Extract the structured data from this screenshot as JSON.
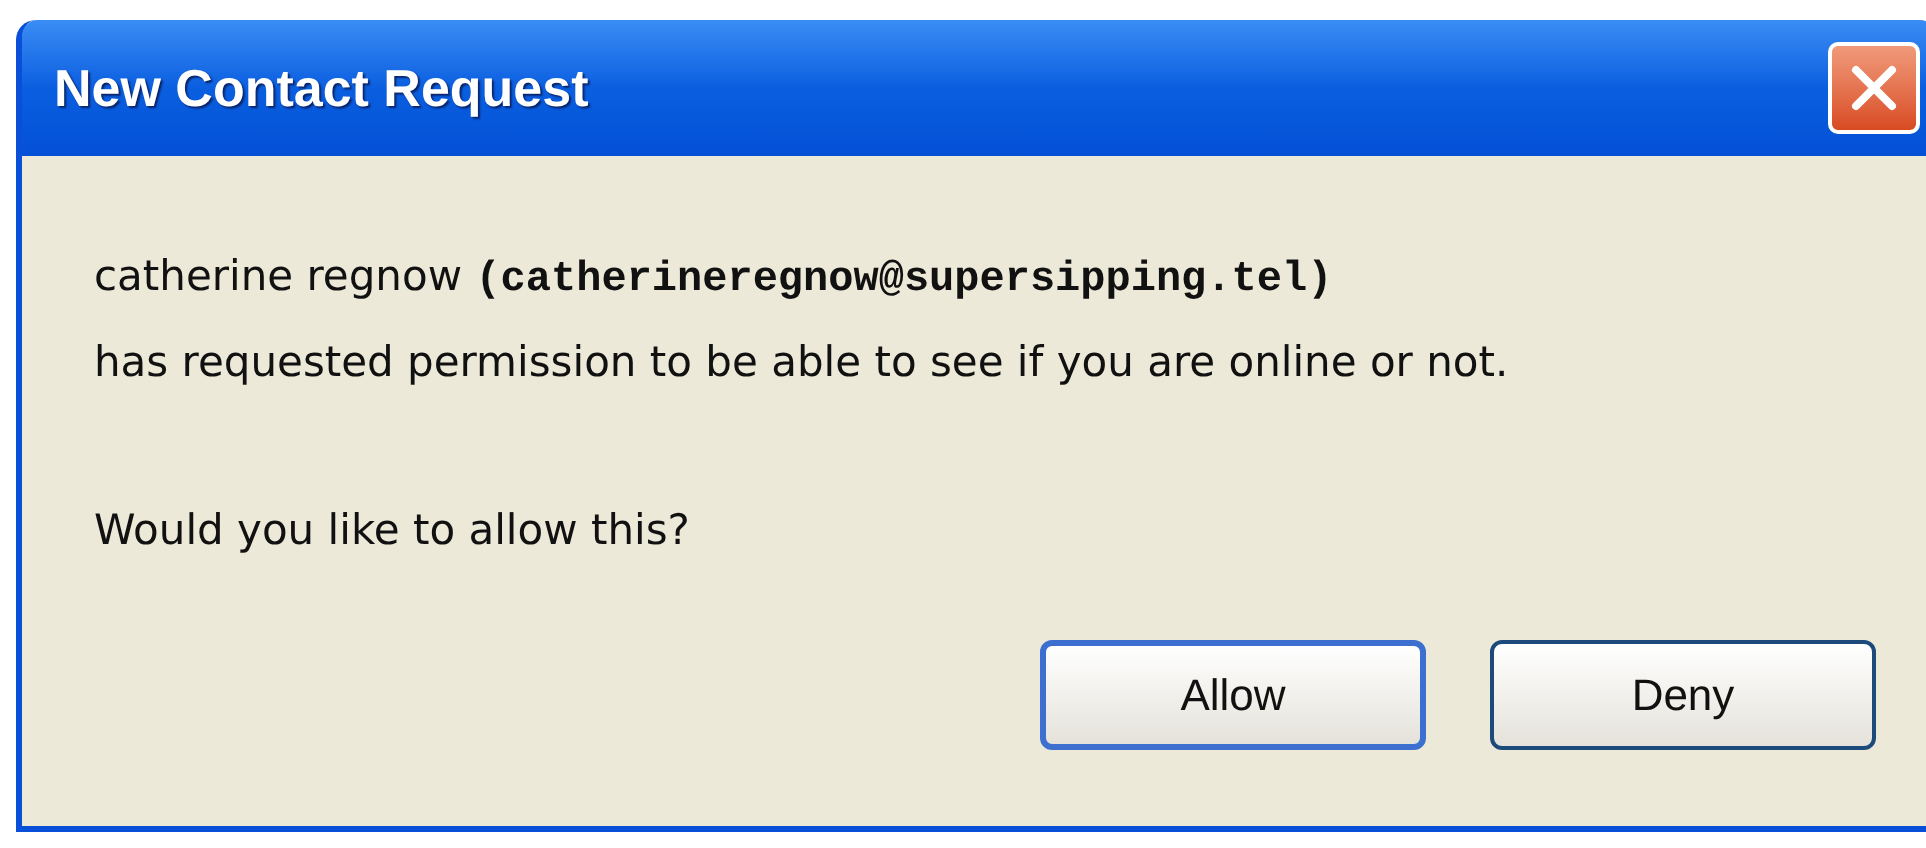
{
  "window": {
    "title": "New Contact Request"
  },
  "message": {
    "sender_name": "catherine regnow",
    "sender_email": "(catherineregnow@supersipping.tel)",
    "line_2": "has requested permission to be able to see if you are online or not.",
    "question": "Would you like to allow this?"
  },
  "buttons": [
    {
      "label": "Allow",
      "default": true
    },
    {
      "label": "Deny",
      "default": false
    }
  ]
}
